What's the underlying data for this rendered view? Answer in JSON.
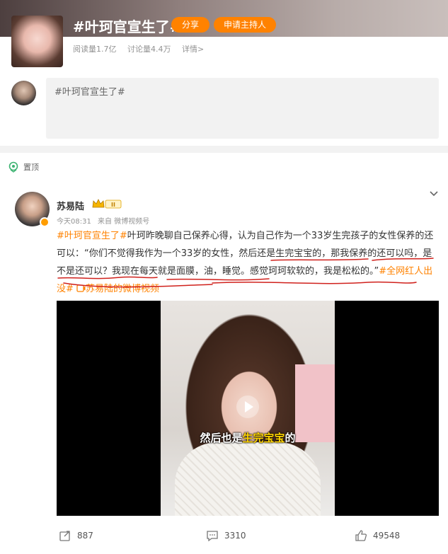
{
  "topic": {
    "title": "#叶珂官宣生了#",
    "share_label": "分享",
    "host_label": "申请主持人",
    "read_count": "阅读量1.7亿",
    "discuss_count": "讨论量4.4万",
    "detail_label": "详情>"
  },
  "compose": {
    "text": "#叶珂官宣生了#"
  },
  "pinned": {
    "label": "置顶"
  },
  "post": {
    "author": "苏易陆",
    "time": "今天08:31",
    "source": "来自 微博视频号",
    "tag1": "#叶珂官宣生了#",
    "body": "叶珂昨晚聊自己保养心得，认为自己作为一个33岁生完孩子的女性保养的还可以：“你们不觉得我作为一个33岁的女性，然后还是生完宝宝的，那我保养的还可以吗，是不是还可以？我现在每天就是面膜，油，睡觉。感觉珂珂软软的，我是松松的。”",
    "tag2": "#全网红人出没#",
    "video_link": "苏易陆的微博视频",
    "video_caption_prefix": "然后也是",
    "video_caption_highlight": "生完宝宝",
    "video_caption_suffix": "的"
  },
  "actions": {
    "repost_count": "887",
    "comment_count": "3310",
    "like_count": "49548"
  },
  "colors": {
    "accent": "#ff8200",
    "annotation": "#d0211c"
  }
}
